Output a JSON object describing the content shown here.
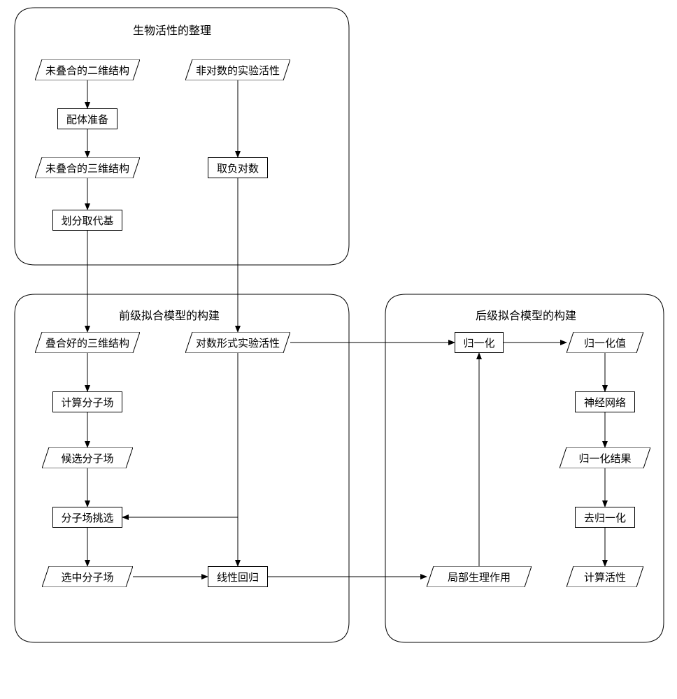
{
  "panels": {
    "p1": {
      "title": "生物活性的整理"
    },
    "p2": {
      "title": "前级拟合模型的构建"
    },
    "p3": {
      "title": "后级拟合模型的构建"
    }
  },
  "boxes": {
    "b_unaligned_2d": {
      "label": "未叠合的二维结构",
      "type": "para"
    },
    "b_nonlog_exp": {
      "label": "非对数的实验活性",
      "type": "para"
    },
    "b_ligand_prep": {
      "label": "配体准备",
      "type": "rect"
    },
    "b_unaligned_3d": {
      "label": "未叠合的三维结构",
      "type": "para"
    },
    "b_neg_log": {
      "label": "取负对数",
      "type": "rect"
    },
    "b_substituent": {
      "label": "划分取代基",
      "type": "rect"
    },
    "b_aligned_3d": {
      "label": "叠合好的三维结构",
      "type": "para"
    },
    "b_log_exp": {
      "label": "对数形式实验活性",
      "type": "para"
    },
    "b_calc_field": {
      "label": "计算分子场",
      "type": "rect"
    },
    "b_cand_field": {
      "label": "候选分子场",
      "type": "para"
    },
    "b_field_select": {
      "label": "分子场挑选",
      "type": "rect"
    },
    "b_selected_field": {
      "label": "选中分子场",
      "type": "para"
    },
    "b_linear_reg": {
      "label": "线性回归",
      "type": "rect"
    },
    "b_normalize": {
      "label": "归一化",
      "type": "rect"
    },
    "b_norm_value": {
      "label": "归一化值",
      "type": "para"
    },
    "b_nn": {
      "label": "神经网络",
      "type": "rect"
    },
    "b_norm_result": {
      "label": "归一化结果",
      "type": "para"
    },
    "b_denorm": {
      "label": "去归一化",
      "type": "rect"
    },
    "b_local_phys": {
      "label": "局部生理作用",
      "type": "para"
    },
    "b_calc_activity": {
      "label": "计算活性",
      "type": "para"
    }
  },
  "chart_data": {
    "type": "flowchart",
    "panels": [
      {
        "id": "p1",
        "title": "生物活性的整理"
      },
      {
        "id": "p2",
        "title": "前级拟合模型的构建"
      },
      {
        "id": "p3",
        "title": "后级拟合模型的构建"
      }
    ],
    "nodes": [
      {
        "id": "b_unaligned_2d",
        "label": "未叠合的二维结构",
        "shape": "parallelogram",
        "panel": "p1"
      },
      {
        "id": "b_nonlog_exp",
        "label": "非对数的实验活性",
        "shape": "parallelogram",
        "panel": "p1"
      },
      {
        "id": "b_ligand_prep",
        "label": "配体准备",
        "shape": "rect",
        "panel": "p1"
      },
      {
        "id": "b_unaligned_3d",
        "label": "未叠合的三维结构",
        "shape": "parallelogram",
        "panel": "p1"
      },
      {
        "id": "b_neg_log",
        "label": "取负对数",
        "shape": "rect",
        "panel": "p1"
      },
      {
        "id": "b_substituent",
        "label": "划分取代基",
        "shape": "rect",
        "panel": "p1"
      },
      {
        "id": "b_aligned_3d",
        "label": "叠合好的三维结构",
        "shape": "parallelogram",
        "panel": "p2"
      },
      {
        "id": "b_log_exp",
        "label": "对数形式实验活性",
        "shape": "parallelogram",
        "panel": "p2"
      },
      {
        "id": "b_calc_field",
        "label": "计算分子场",
        "shape": "rect",
        "panel": "p2"
      },
      {
        "id": "b_cand_field",
        "label": "候选分子场",
        "shape": "parallelogram",
        "panel": "p2"
      },
      {
        "id": "b_field_select",
        "label": "分子场挑选",
        "shape": "rect",
        "panel": "p2"
      },
      {
        "id": "b_selected_field",
        "label": "选中分子场",
        "shape": "parallelogram",
        "panel": "p2"
      },
      {
        "id": "b_linear_reg",
        "label": "线性回归",
        "shape": "rect",
        "panel": "p2"
      },
      {
        "id": "b_normalize",
        "label": "归一化",
        "shape": "rect",
        "panel": "p3"
      },
      {
        "id": "b_norm_value",
        "label": "归一化值",
        "shape": "parallelogram",
        "panel": "p3"
      },
      {
        "id": "b_nn",
        "label": "神经网络",
        "shape": "rect",
        "panel": "p3"
      },
      {
        "id": "b_norm_result",
        "label": "归一化结果",
        "shape": "parallelogram",
        "panel": "p3"
      },
      {
        "id": "b_denorm",
        "label": "去归一化",
        "shape": "rect",
        "panel": "p3"
      },
      {
        "id": "b_local_phys",
        "label": "局部生理作用",
        "shape": "parallelogram",
        "panel": "p3"
      },
      {
        "id": "b_calc_activity",
        "label": "计算活性",
        "shape": "parallelogram",
        "panel": "p3"
      }
    ],
    "edges": [
      {
        "from": "b_unaligned_2d",
        "to": "b_ligand_prep"
      },
      {
        "from": "b_ligand_prep",
        "to": "b_unaligned_3d"
      },
      {
        "from": "b_unaligned_3d",
        "to": "b_substituent"
      },
      {
        "from": "b_nonlog_exp",
        "to": "b_neg_log"
      },
      {
        "from": "b_substituent",
        "to": "b_aligned_3d"
      },
      {
        "from": "b_neg_log",
        "to": "b_log_exp"
      },
      {
        "from": "b_aligned_3d",
        "to": "b_calc_field"
      },
      {
        "from": "b_calc_field",
        "to": "b_cand_field"
      },
      {
        "from": "b_cand_field",
        "to": "b_field_select"
      },
      {
        "from": "b_field_select",
        "to": "b_selected_field"
      },
      {
        "from": "b_log_exp",
        "to": "b_field_select"
      },
      {
        "from": "b_log_exp",
        "to": "b_linear_reg"
      },
      {
        "from": "b_selected_field",
        "to": "b_linear_reg"
      },
      {
        "from": "b_log_exp",
        "to": "b_normalize"
      },
      {
        "from": "b_linear_reg",
        "to": "b_local_phys"
      },
      {
        "from": "b_local_phys",
        "to": "b_normalize"
      },
      {
        "from": "b_normalize",
        "to": "b_norm_value"
      },
      {
        "from": "b_norm_value",
        "to": "b_nn"
      },
      {
        "from": "b_nn",
        "to": "b_norm_result"
      },
      {
        "from": "b_norm_result",
        "to": "b_denorm"
      },
      {
        "from": "b_denorm",
        "to": "b_calc_activity"
      }
    ]
  }
}
